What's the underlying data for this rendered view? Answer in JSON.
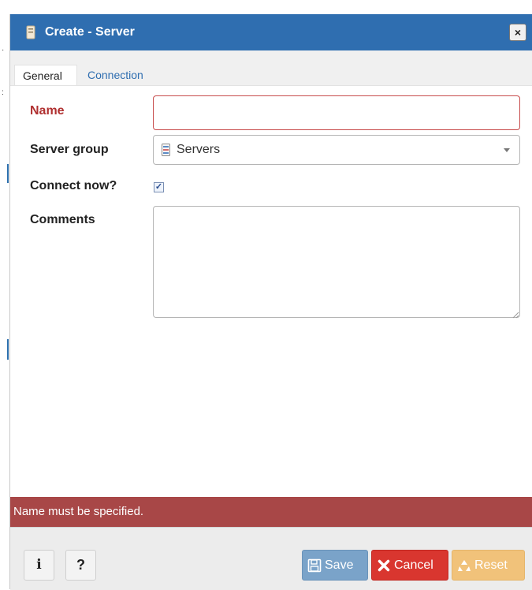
{
  "dialog": {
    "title": "Create - Server",
    "close_label": "×"
  },
  "tabs": [
    {
      "label": "General",
      "active": true
    },
    {
      "label": "Connection",
      "active": false
    }
  ],
  "form": {
    "name": {
      "label": "Name",
      "value": "",
      "state": "error"
    },
    "server_group": {
      "label": "Server group",
      "value": "Servers"
    },
    "connect_now": {
      "label": "Connect now?",
      "checked": true,
      "check_glyph": "✓"
    },
    "comments": {
      "label": "Comments",
      "value": ""
    }
  },
  "error_message": "Name must be specified.",
  "footer": {
    "info_label": "i",
    "help_label": "?",
    "save_label": "Save",
    "cancel_label": "Cancel",
    "reset_label": "Reset"
  },
  "colors": {
    "titlebar": "#2f6eb0",
    "error": "#a84747",
    "save": "#7aa3c9",
    "cancel": "#d9362f",
    "reset": "#f1c27a"
  }
}
